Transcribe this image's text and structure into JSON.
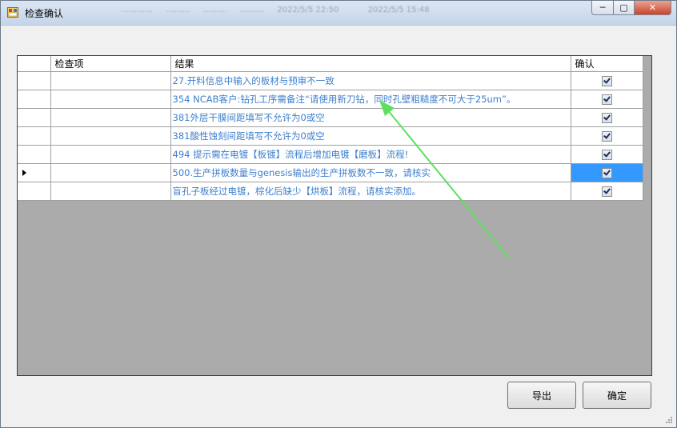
{
  "window": {
    "title": "检查确认",
    "background_text": "………… 　 ……… 　 ……… 　 ……… 　 2022/5/5 22:50 　　　 2022/5/5 15:48"
  },
  "grid": {
    "headers": [
      "检查项",
      "结果",
      "确认"
    ],
    "rows": [
      {
        "item": "",
        "result": "27.开料信息中输入的板材与预审不一致",
        "confirmed": true,
        "selected": false
      },
      {
        "item": "",
        "result": "354 NCAB客户:钻孔工序需备注“请使用新刀钻，同时孔壁粗糙度不可大于25um”。",
        "confirmed": true,
        "selected": false
      },
      {
        "item": "",
        "result": "381外层干膜间距填写不允许为0或空",
        "confirmed": true,
        "selected": false
      },
      {
        "item": "",
        "result": "381酸性蚀刻间距填写不允许为0或空",
        "confirmed": true,
        "selected": false
      },
      {
        "item": "",
        "result": "494 提示需在电镀【板镀】流程后增加电镀【磨板】流程!",
        "confirmed": true,
        "selected": false
      },
      {
        "item": "",
        "result": "500.生产拼板数量与genesis输出的生产拼板数不一致，请核实",
        "confirmed": true,
        "selected": true
      },
      {
        "item": "",
        "result": "盲孔子板经过电镀，棕化后缺少【烘板】流程，请核实添加。",
        "confirmed": true,
        "selected": false
      }
    ],
    "current_row_index": 5
  },
  "buttons": {
    "export_label": "导出",
    "ok_label": "确定"
  },
  "colors": {
    "result_text": "#3e7fcd",
    "selection": "#3399ff",
    "annotation_arrow": "#5ee05e",
    "grid_empty": "#ababab"
  }
}
